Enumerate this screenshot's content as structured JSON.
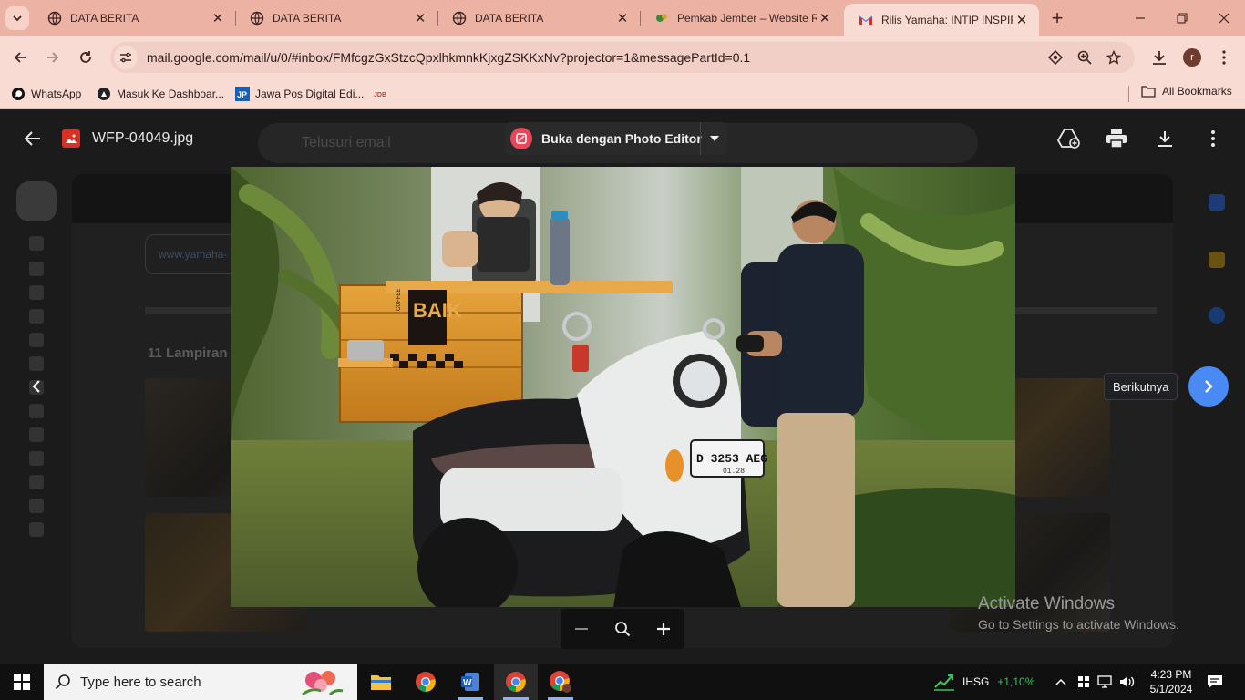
{
  "browser": {
    "tabs": [
      {
        "title": "DATA BERITA",
        "active": false
      },
      {
        "title": "DATA BERITA",
        "active": false
      },
      {
        "title": "DATA BERITA",
        "active": false
      },
      {
        "title": "Pemkab Jember – Website R",
        "active": false
      },
      {
        "title": "Rilis Yamaha: INTIP INSPIRAS",
        "active": true
      }
    ],
    "url": "mail.google.com/mail/u/0/#inbox/FMfcgzGxStzcQpxlhkmnkKjxgZSKKxNv?projector=1&messagePartId=0.1",
    "profile_initial": "r",
    "bookmarks": [
      {
        "label": "WhatsApp"
      },
      {
        "label": "Masuk Ke Dashboar..."
      },
      {
        "label": "Jawa Pos Digital Edi..."
      }
    ],
    "all_bookmarks_label": "All Bookmarks"
  },
  "gmail_backdrop": {
    "search_placeholder": "Telusuri email",
    "link_chip": "www.yamaha-",
    "attachments_label": "11 Lampiran"
  },
  "viewer": {
    "file_name": "WFP-04049.jpg",
    "open_with_label": "Buka dengan Photo Editor",
    "next_tooltip": "Berikutnya",
    "photo": {
      "crate_text_left": "COFFEE",
      "crate_text": "BAIK",
      "plate": "D 3253 AEG",
      "plate_sub": "01.28"
    }
  },
  "watermark": {
    "line1": "Activate Windows",
    "line2": "Go to Settings to activate Windows."
  },
  "taskbar": {
    "search_placeholder": "Type here to search",
    "ticker_name": "IHSG",
    "ticker_change": "+1,10%",
    "time": "4:23 PM",
    "date": "5/1/2024"
  },
  "colors": {
    "tab_strip": "#ecb3a5",
    "toolbar": "#f8dbd3",
    "accent_blue": "#4a8af4",
    "ticker_green": "#3fbf5f"
  }
}
